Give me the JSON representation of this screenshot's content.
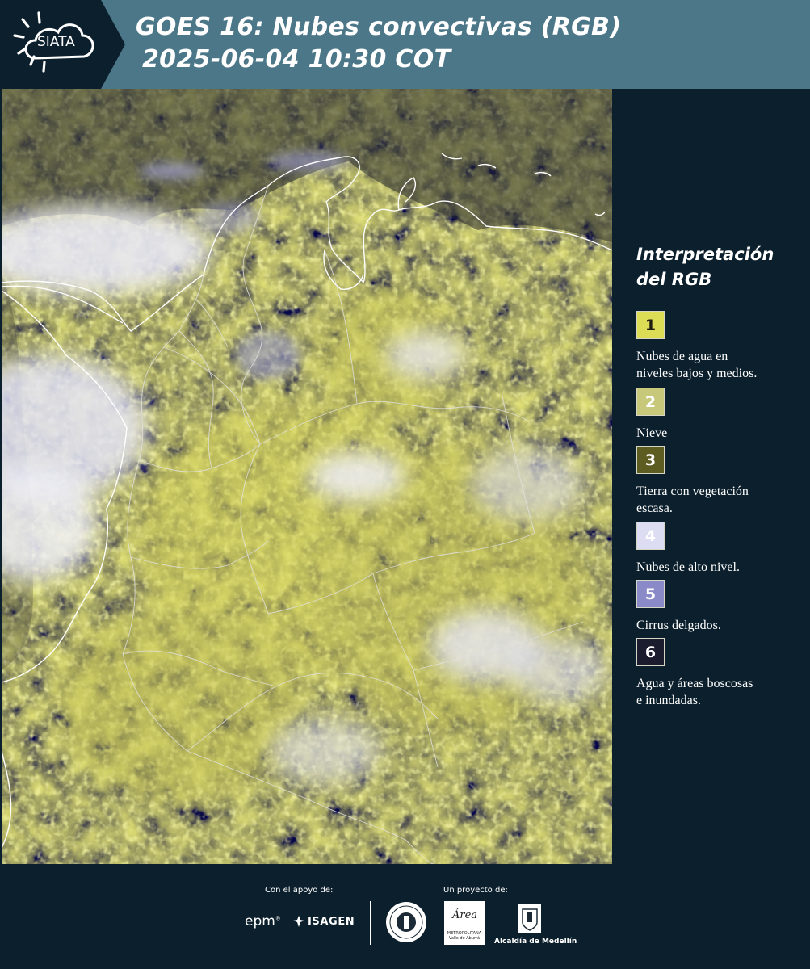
{
  "header": {
    "logo_text": "SIATA",
    "title_line1": "GOES 16: Nubes convectivas (RGB)",
    "title_line2": "2025-06-04 10:30 COT",
    "background_color": "#4b7788",
    "logo_panel_color": "#0c1f2c"
  },
  "map": {
    "icon": "satellite-image",
    "coastline_color": "#ffffff",
    "border_color": "#d8d8d8"
  },
  "legend": {
    "title_line1": "Interpretación",
    "title_line2": "del RGB",
    "items": [
      {
        "number": "1",
        "color": "#dcdc55",
        "text_color": "#1f1f10",
        "line1": "Nubes de agua en",
        "line2": "niveles bajos y medios."
      },
      {
        "number": "2",
        "color": "#c7c879",
        "text_color": "#ffffff",
        "line1": "Nieve",
        "line2": ""
      },
      {
        "number": "3",
        "color": "#5e5d21",
        "text_color": "#ffffff",
        "line1": "Tierra con vegetación",
        "line2": "escasa."
      },
      {
        "number": "4",
        "color": "#dcdcf2",
        "text_color": "#ffffff",
        "line1": "Nubes de alto nivel.",
        "line2": ""
      },
      {
        "number": "5",
        "color": "#8b8ac8",
        "text_color": "#ffffff",
        "line1": "Cirrus delgados.",
        "line2": ""
      },
      {
        "number": "6",
        "color": "#1b1c2e",
        "text_color": "#ffffff",
        "line1": "Agua y áreas boscosas",
        "line2": "e inundadas."
      }
    ]
  },
  "footer": {
    "support_label": "Con el apoyo de:",
    "project_label": "Un proyecto de:",
    "epm_text": "epm",
    "isagen_text": "ISAGEN",
    "area_word": "Área",
    "area_sub": "METROPOLITANA Valle de Aburrá",
    "alcaldia_text": "Alcaldía de Medellín"
  }
}
